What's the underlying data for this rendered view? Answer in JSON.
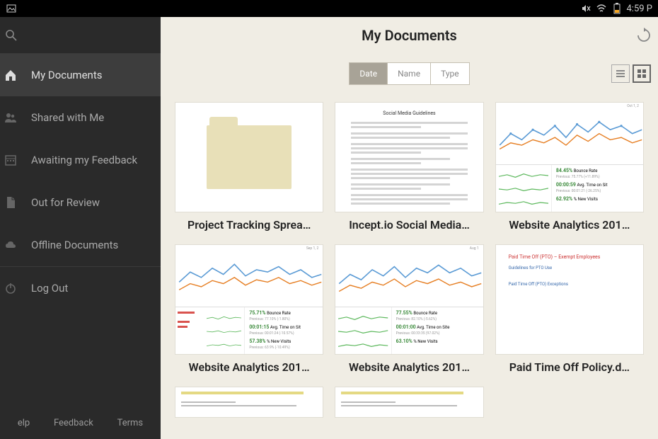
{
  "statusBar": {
    "time": "4:59 P"
  },
  "sidebar": {
    "items": [
      {
        "label": "My Documents",
        "icon": "home"
      },
      {
        "label": "Shared with Me",
        "icon": "people"
      },
      {
        "label": "Awaiting my Feedback",
        "icon": "calendar"
      },
      {
        "label": "Out for Review",
        "icon": "doc"
      },
      {
        "label": "Offline Documents",
        "icon": "cloud"
      },
      {
        "label": "Log Out",
        "icon": "power"
      }
    ],
    "footer": {
      "help": "elp",
      "feedback": "Feedback",
      "terms": "Terms"
    }
  },
  "content": {
    "title": "My Documents",
    "sort": {
      "date": "Date",
      "name": "Name",
      "type": "Type"
    },
    "documents": [
      {
        "title": "Project Tracking Sprea…"
      },
      {
        "title": "Incept.io Social Media…"
      },
      {
        "title": "Website Analytics 201…"
      },
      {
        "title": "Website Analytics 201…"
      },
      {
        "title": "Website Analytics 201…"
      },
      {
        "title": "Paid Time Off Policy.d…"
      }
    ],
    "analytics": {
      "date1": "Oct 1, 2",
      "date2": "Sep 1, 2",
      "date3": "Aug 1",
      "stats1": {
        "bounce": "84.45%",
        "bounceLabel": "Bounce Rate",
        "bounceSub": "Previous: 75.77% (+11.89%)",
        "time": "00:00:59",
        "timeLabel": "Avg. Time on Sit",
        "timeSub": "Previous: 00:01:21 (-26.25%)",
        "visits": "62.92%",
        "visitsLabel": "% New Visits",
        "visitsSub": ""
      },
      "stats2": {
        "bounce": "75.71%",
        "bounceLabel": "Bounce Rate",
        "bounceSub": "Previous: 77.10% (-1.80%)",
        "time": "00:01:15",
        "timeLabel": "Avg. Time on Sit",
        "timeSub": "Previous: 00:01:24 (-10.57%)",
        "visits": "57.38%",
        "visitsLabel": "% New Visits",
        "visitsSub": "Previous: 63.9% (-10.49%)"
      },
      "stats3": {
        "bounce": "77.55%",
        "bounceLabel": "Bounce Rate",
        "bounceSub": "Previous: 82.10% (-5.62%)",
        "time": "00:01:00",
        "timeLabel": "Avg. Time on Site",
        "timeSub": "Previous: 00:33:35 (97.02%)",
        "visits": "63.10%",
        "visitsLabel": "% New Visits",
        "visitsSub": ""
      }
    },
    "textDoc": {
      "title": "Social Media Guidelines"
    },
    "ptoDoc": {
      "heading1": "Paid Time Off (PTO) – Exempt Employees",
      "heading2": "Guidelines for PTO Use",
      "heading3": "Paid Time Off (PTO) Exceptions"
    }
  }
}
